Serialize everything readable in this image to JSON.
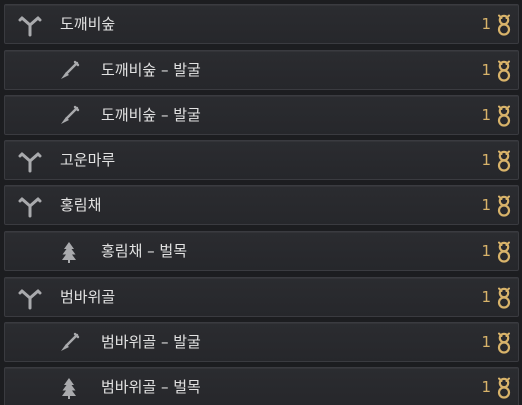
{
  "nodes": [
    {
      "type": "region",
      "label": "도깨비숲",
      "count": "1",
      "icon": "crossroad-icon"
    },
    {
      "type": "node",
      "label": "도깨비숲 – 발굴",
      "count": "1",
      "icon": "shovel-icon"
    },
    {
      "type": "node",
      "label": "도깨비숲 – 발굴",
      "count": "1",
      "icon": "shovel-icon"
    },
    {
      "type": "region",
      "label": "고운마루",
      "count": "1",
      "icon": "crossroad-icon"
    },
    {
      "type": "region",
      "label": "홍림채",
      "count": "1",
      "icon": "crossroad-icon"
    },
    {
      "type": "node",
      "label": "홍림채 – 벌목",
      "count": "1",
      "icon": "tree-icon"
    },
    {
      "type": "region",
      "label": "범바위골",
      "count": "1",
      "icon": "crossroad-icon"
    },
    {
      "type": "node",
      "label": "범바위골 – 발굴",
      "count": "1",
      "icon": "shovel-icon"
    },
    {
      "type": "node",
      "label": "범바위골 – 벌목",
      "count": "1",
      "icon": "tree-icon"
    }
  ],
  "colors": {
    "accent_gold": "#d8b36a",
    "row_bg": "#2a2b2f",
    "text": "#e2e2e2",
    "icon_gray": "#a9aaad"
  }
}
